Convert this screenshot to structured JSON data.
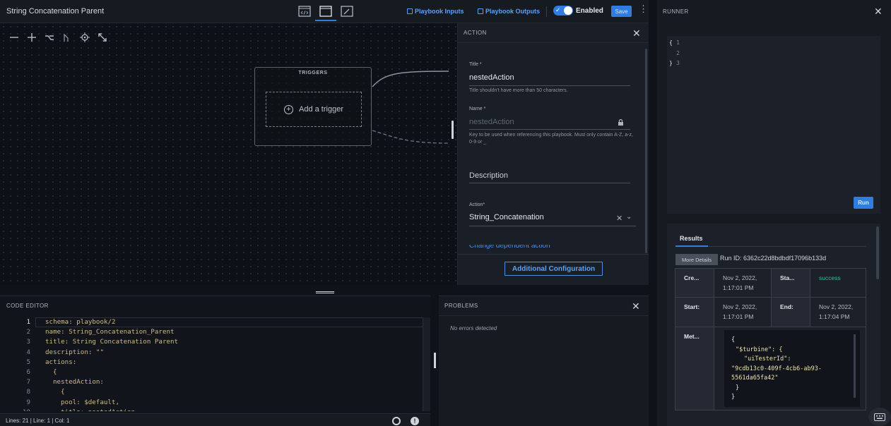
{
  "app": {
    "title": "String Concatenation Parent"
  },
  "toolbar": {
    "views": [
      "code-view-icon",
      "split-view-icon",
      "designer-view-icon"
    ],
    "playbook_inputs": "Playbook Inputs",
    "playbook_outputs": "Playbook Outputs",
    "enabled_label": "Enabled",
    "save_label": "Save"
  },
  "canvas": {
    "tools": [
      "zoom-out-icon",
      "zoom-in-icon",
      "branch-icon",
      "path-icon",
      "target-icon",
      "expand-icon"
    ],
    "triggers_label": "TRIGGERS",
    "add_trigger_label": "Add a trigger"
  },
  "action_panel": {
    "header": "ACTION",
    "title_label": "Title *",
    "title_value": "nestedAction",
    "title_help": "Title shouldn't have more than 50 characters.",
    "name_label": "Name *",
    "name_placeholder": "nestedAction",
    "name_help": "Key to be used when referencing this playbook. Must only contain A-Z, a-z, 0-9 or _",
    "description_label": "Description",
    "action_label": "Action*",
    "action_value": "String_Concatenation",
    "cut_off_text": "Change dependent action",
    "additional_config": "Additional Configuration"
  },
  "code_editor": {
    "header": "CODE EDITOR",
    "lines": [
      {
        "n": "1",
        "indent": 0,
        "t": "schema: playbook/2"
      },
      {
        "n": "2",
        "indent": 0,
        "t": "name: String_Concatenation_Parent"
      },
      {
        "n": "3",
        "indent": 0,
        "t": "title: String Concatenation Parent"
      },
      {
        "n": "4",
        "indent": 0,
        "t": "description: \"\""
      },
      {
        "n": "5",
        "indent": 0,
        "t": "actions:"
      },
      {
        "n": "6",
        "indent": 1,
        "t": "{"
      },
      {
        "n": "7",
        "indent": 1,
        "t": "nestedAction:"
      },
      {
        "n": "8",
        "indent": 2,
        "t": "{"
      },
      {
        "n": "9",
        "indent": 2,
        "t": "pool: $default,"
      },
      {
        "n": "10",
        "indent": 2,
        "t": "title: nestedAction"
      }
    ],
    "status": "Lines: 21 | Line: 1 | Col: 1"
  },
  "problems": {
    "header": "PROBLEMS",
    "empty": "No errors detected"
  },
  "runner": {
    "header": "RUNNER",
    "editor_lines": [
      {
        "b": "{",
        "n": "1"
      },
      {
        "b": "",
        "n": "2"
      },
      {
        "b": "}",
        "n": "3"
      }
    ],
    "run_label": "Run",
    "results_tab": "Results",
    "more_details": "More Details",
    "run_id": "Run ID: 6362c22d8bdbdf17096b133d",
    "row1": {
      "h1": "Cre...",
      "v1a": "Nov 2, 2022,",
      "v1b": "1:17:01 PM",
      "h2": "Sta...",
      "v2": "success"
    },
    "row2": {
      "h1": "Start:",
      "v1a": "Nov 2, 2022,",
      "v1b": "1:17:01 PM",
      "h2": "End:",
      "v2a": "Nov 2, 2022,",
      "v2b": "1:17:04 PM"
    },
    "row3": {
      "h1": "Met...",
      "json_l1": "{",
      "json_l2": "\"$turbine\": {",
      "json_l3": "\"uiTesterId\":",
      "json_l4": "\"9cdb13c0-409f-4cb6-ab93-",
      "json_l5": "5561da65fa42\"",
      "json_l6": "}",
      "json_l7": "}"
    }
  }
}
